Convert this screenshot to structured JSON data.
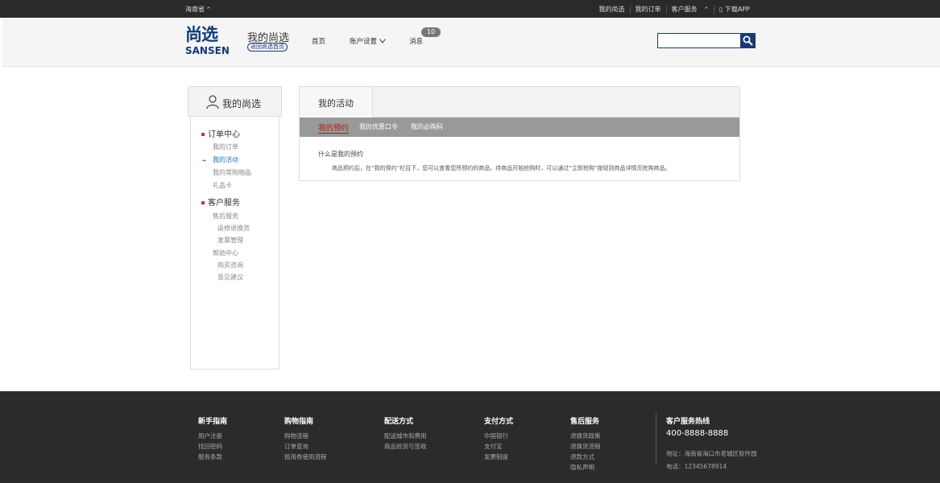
{
  "topbar": {
    "location": "海南省",
    "links": [
      "我的尚选",
      "我的订单",
      "客户服务",
      "下载APP"
    ]
  },
  "header": {
    "logo_cn": "尚选",
    "logo_en": "SANSEN",
    "title": "我的尚选",
    "back_home": "返回尚选首页",
    "nav_home": "首页",
    "nav_account": "账户设置",
    "nav_messages": "消息",
    "message_count": "10",
    "search_placeholder": ""
  },
  "sidebar": {
    "title": "我的尚选",
    "section_orders": "订单中心",
    "orders_items": [
      "我的订单",
      "我的活动",
      "我的常购物品",
      "礼品卡"
    ],
    "section_service": "客户服务",
    "service_items": [
      "售后服务",
      "返修退换货",
      "发票管理",
      "帮助中心",
      "购买咨询",
      "意见建议"
    ]
  },
  "main": {
    "tab": "我的活动",
    "subtabs": [
      "我的预约",
      "我的优惠口令",
      "我的必购码"
    ],
    "question": "什么是我的预约",
    "answer": "商品预约后，在“我的预约”栏目下，您可以查看您所预约的商品，待商品开始抢购时，可以通过“立即抢购”按钮到商品详情页抢购商品。"
  },
  "footer": {
    "cols": [
      {
        "head": "新手指南",
        "items": [
          "用户注册",
          "找回密码",
          "服务条款"
        ]
      },
      {
        "head": "购物指南",
        "items": [
          "购物流程",
          "订单查询",
          "抵用券使用流程"
        ]
      },
      {
        "head": "配送方式",
        "items": [
          "配送城市和费用",
          "商品验货与签收"
        ]
      },
      {
        "head": "支付方式",
        "items": [
          "中国银行",
          "支付宝",
          "发票制度"
        ]
      },
      {
        "head": "售后服务",
        "items": [
          "退换货政策",
          "退换货流程",
          "退款方式",
          "隐私声明"
        ]
      }
    ],
    "hotline_label": "客户服务热线",
    "hotline": "400-8888-8888",
    "address": "地址：海南省海口市老城区软件园",
    "phone": "电话：12345678914"
  }
}
